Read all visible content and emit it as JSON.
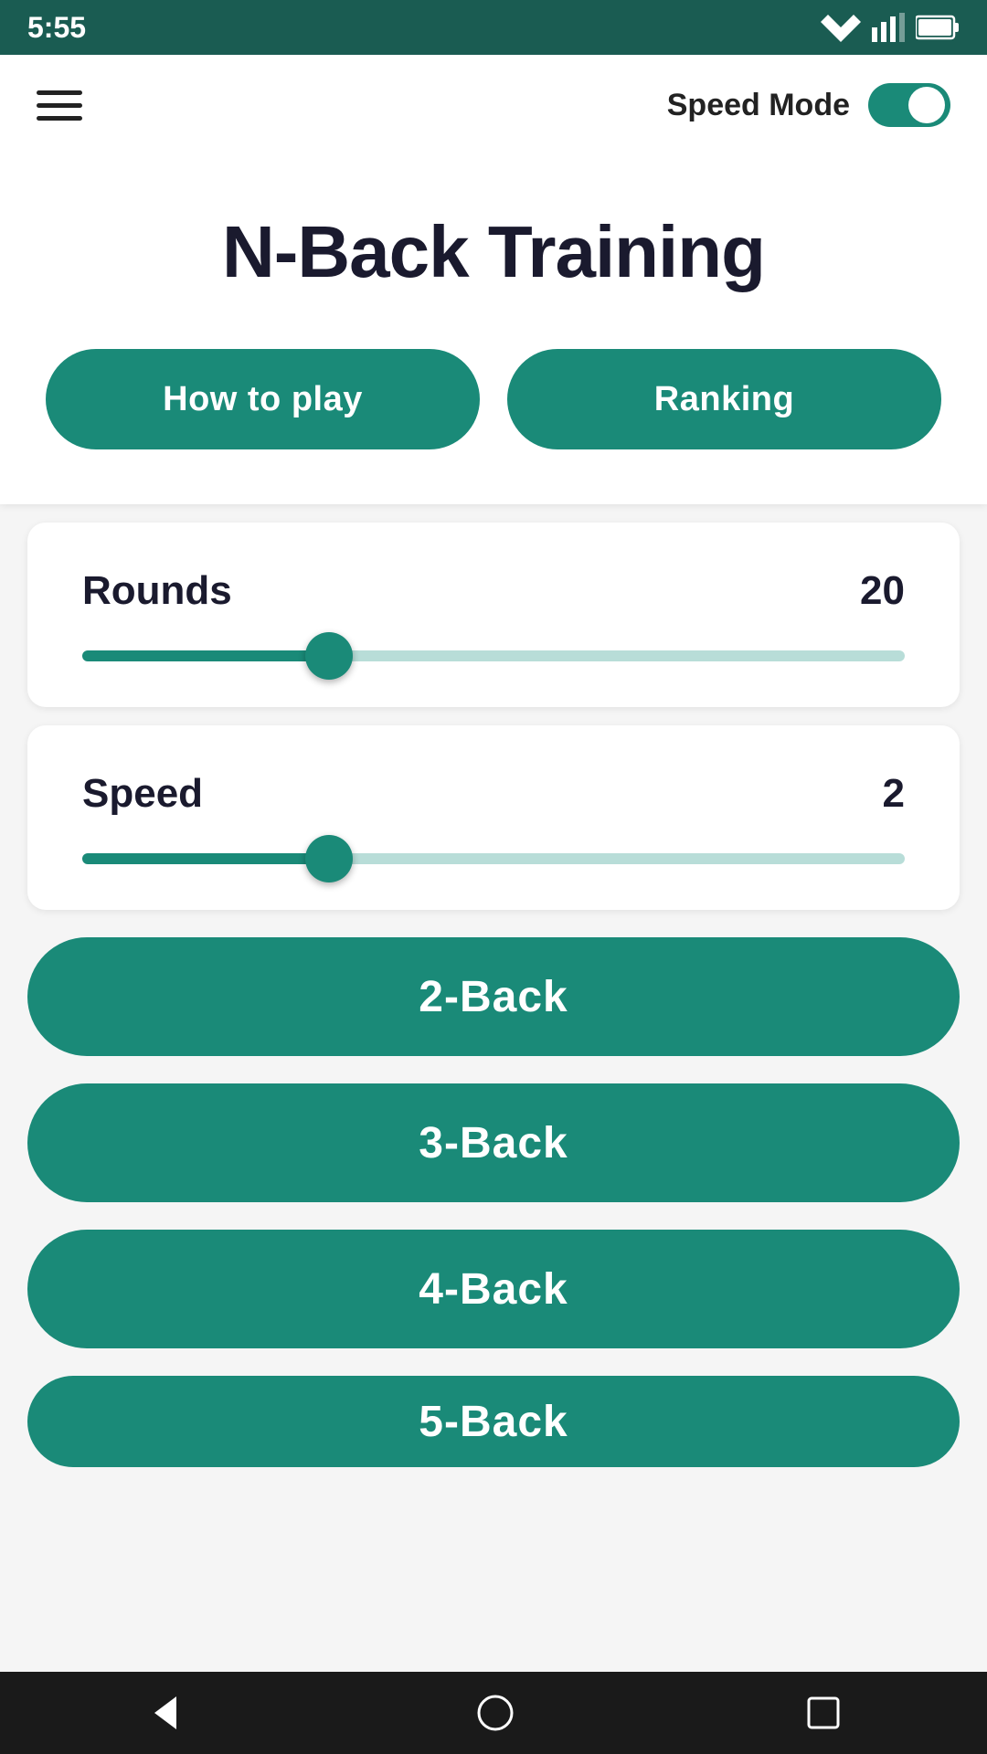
{
  "status_bar": {
    "time": "5:55"
  },
  "app_bar": {
    "speed_mode_label": "Speed Mode"
  },
  "header": {
    "title": "N-Back Training",
    "how_to_play_label": "How to play",
    "ranking_label": "Ranking"
  },
  "rounds_slider": {
    "label": "Rounds",
    "value": "20",
    "percent": 30
  },
  "speed_slider": {
    "label": "Speed",
    "value": "2",
    "percent": 30
  },
  "game_buttons": [
    {
      "label": "2-Back",
      "id": "2back"
    },
    {
      "label": "3-Back",
      "id": "3back"
    },
    {
      "label": "4-Back",
      "id": "4back"
    },
    {
      "label": "5-Back",
      "id": "5back"
    }
  ],
  "bottom_nav": {
    "back_label": "back",
    "home_label": "home",
    "recents_label": "recents"
  },
  "colors": {
    "teal": "#1a8a78",
    "dark": "#1a1a2e"
  }
}
